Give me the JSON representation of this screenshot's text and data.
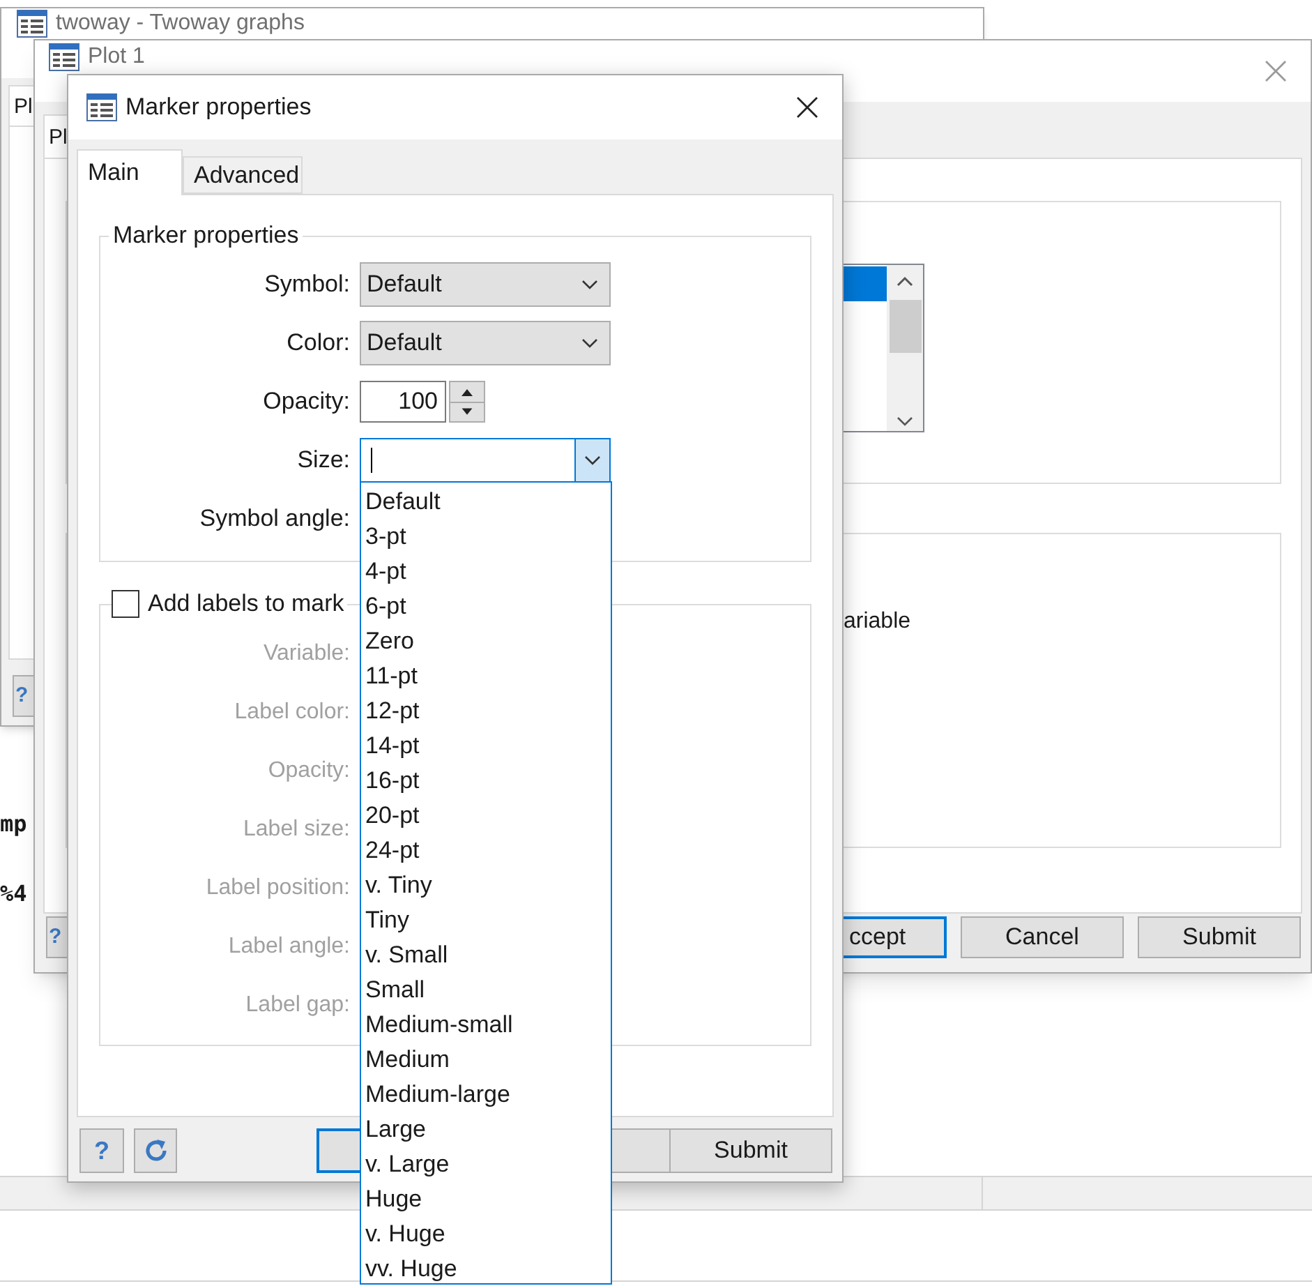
{
  "console": {
    "lines": [
      "mp",
      "%4"
    ]
  },
  "back_window": {
    "title": "twoway - Twoway graphs",
    "tab": "Pl",
    "help_button": "?"
  },
  "plot_window": {
    "title": "Plot 1",
    "tab": "Pl",
    "partial_text": "ariable",
    "help_button": "?",
    "buttons": [
      {
        "label": "ccept",
        "focused": true
      },
      {
        "label": "Cancel",
        "focused": false
      },
      {
        "label": "Submit",
        "focused": false
      }
    ]
  },
  "dialog": {
    "title": "Marker properties",
    "tabs": [
      {
        "label": "Main",
        "selected": true
      },
      {
        "label": "Advanced",
        "selected": false
      }
    ],
    "group_title": "Marker properties",
    "fields": [
      {
        "label": "Symbol:",
        "kind": "select",
        "value": "Default"
      },
      {
        "label": "Color:",
        "kind": "select",
        "value": "Default"
      },
      {
        "label": "Opacity:",
        "kind": "spinner",
        "value": "100"
      },
      {
        "label": "Size:",
        "kind": "combo",
        "expanded": true
      },
      {
        "label": "Symbol angle:",
        "kind": "covered"
      }
    ],
    "labels_checkbox": {
      "label": "Add labels to mark",
      "checked": false
    },
    "label_fields": [
      {
        "label": "Variable:",
        "disabled": true
      },
      {
        "label": "Label color:",
        "disabled": true
      },
      {
        "label": "Opacity:",
        "disabled": true
      },
      {
        "label": "Label size:",
        "disabled": true
      },
      {
        "label": "Label position:",
        "disabled": true
      },
      {
        "label": "Label angle:",
        "disabled": true
      },
      {
        "label": "Label gap:",
        "disabled": true
      }
    ],
    "help_button": "?",
    "buttons": [
      {
        "kind": "covered",
        "focused": true
      },
      {
        "kind": "covered",
        "focused": false
      },
      {
        "kind": "text",
        "label": "Submit",
        "focused": false
      }
    ],
    "size_options": [
      "Default",
      "3-pt",
      "4-pt",
      "6-pt",
      "Zero",
      "11-pt",
      "12-pt",
      "14-pt",
      "16-pt",
      "20-pt",
      "24-pt",
      "v. Tiny",
      "Tiny",
      "v. Small",
      "Small",
      "Medium-small",
      "Medium",
      "Medium-large",
      "Large",
      "v. Large",
      "Huge",
      "v. Huge",
      "vv. Huge"
    ]
  }
}
